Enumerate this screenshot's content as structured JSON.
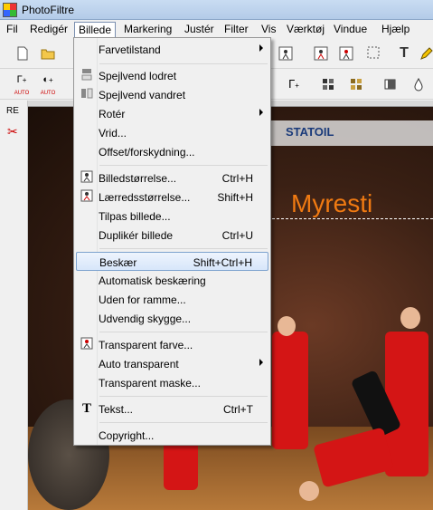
{
  "window": {
    "title": "PhotoFiltre"
  },
  "menubar": {
    "items": [
      {
        "label": "Fil"
      },
      {
        "label": "Redigér"
      },
      {
        "label": "Billede"
      },
      {
        "label": "Markering"
      },
      {
        "label": "Justér"
      },
      {
        "label": "Filter"
      },
      {
        "label": "Vis"
      },
      {
        "label": "Værktøj"
      },
      {
        "label": "Vindue"
      },
      {
        "label": "Hjælp"
      }
    ]
  },
  "toolbar2": {
    "auto_label_1": "AUTO",
    "auto_label_2": "AUTO"
  },
  "leftpanel": {
    "label": "RE"
  },
  "canvas": {
    "overlay_text": "Myresti",
    "banner_text": "STATOIL"
  },
  "dropdown": {
    "items": [
      {
        "label": "Farvetilstand",
        "shortcut": "",
        "submenu": true,
        "icon": ""
      },
      {
        "label": "Spejlvend lodret",
        "shortcut": "",
        "submenu": false,
        "icon": "flip-vertical-icon"
      },
      {
        "label": "Spejlvend vandret",
        "shortcut": "",
        "submenu": false,
        "icon": "flip-horizontal-icon"
      },
      {
        "label": "Rotér",
        "shortcut": "",
        "submenu": true,
        "icon": ""
      },
      {
        "label": "Vrid...",
        "shortcut": "",
        "submenu": false,
        "icon": ""
      },
      {
        "label": "Offset/forskydning...",
        "shortcut": "",
        "submenu": false,
        "icon": ""
      },
      {
        "label": "Billedstørrelse...",
        "shortcut": "Ctrl+H",
        "submenu": false,
        "icon": "image-size-icon"
      },
      {
        "label": "Lærredsstørrelse...",
        "shortcut": "Shift+H",
        "submenu": false,
        "icon": "canvas-size-icon"
      },
      {
        "label": "Tilpas billede...",
        "shortcut": "",
        "submenu": false,
        "icon": ""
      },
      {
        "label": "Duplikér billede",
        "shortcut": "Ctrl+U",
        "submenu": false,
        "icon": ""
      },
      {
        "label": "Beskær",
        "shortcut": "Shift+Ctrl+H",
        "submenu": false,
        "icon": ""
      },
      {
        "label": "Automatisk beskæring",
        "shortcut": "",
        "submenu": false,
        "icon": ""
      },
      {
        "label": "Uden for ramme...",
        "shortcut": "",
        "submenu": false,
        "icon": ""
      },
      {
        "label": "Udvendig skygge...",
        "shortcut": "",
        "submenu": false,
        "icon": ""
      },
      {
        "label": "Transparent farve...",
        "shortcut": "",
        "submenu": false,
        "icon": "transparent-color-icon"
      },
      {
        "label": "Auto transparent",
        "shortcut": "",
        "submenu": true,
        "icon": ""
      },
      {
        "label": "Transparent maske...",
        "shortcut": "",
        "submenu": false,
        "icon": ""
      },
      {
        "label": "Tekst...",
        "shortcut": "Ctrl+T",
        "submenu": false,
        "icon": "text-icon",
        "glyph": "T"
      },
      {
        "label": "Copyright...",
        "shortcut": "",
        "submenu": false,
        "icon": ""
      }
    ],
    "highlighted": "Beskær"
  },
  "colors": {
    "overlay_text": "#f07a12",
    "highlight_border": "#7da2ce",
    "menu_bg": "#f0f0f0"
  }
}
